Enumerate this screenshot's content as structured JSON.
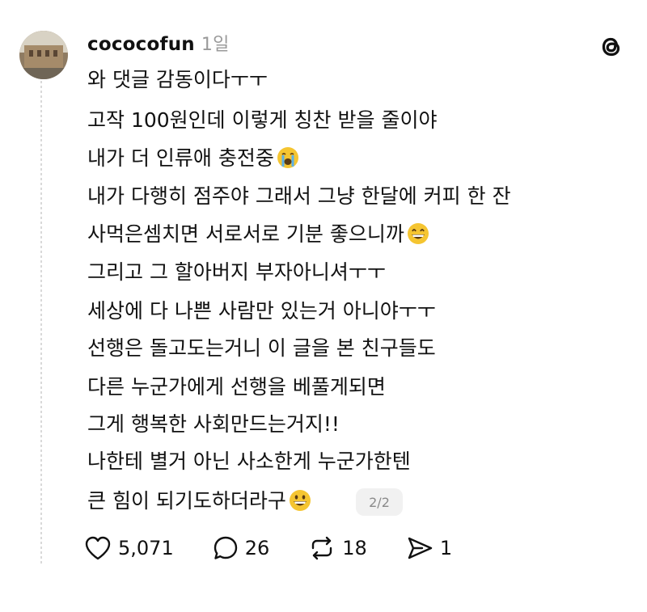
{
  "post": {
    "username": "cococofun",
    "timestamp": "1일",
    "lines": [
      {
        "text": "와 댓글 감동이다ㅜㅜ",
        "emoji": null
      },
      {
        "text": "고작 100원인데 이렇게 칭찬 받을 줄이야",
        "emoji": null
      },
      {
        "text": "내가 더 인류애 충전중",
        "emoji": "crying-face-icon"
      },
      {
        "text": "내가 다행히 점주야 그래서 그냥 한달에 커피 한 잔",
        "emoji": null
      },
      {
        "text": "사먹은셈치면 서로서로 기분 좋으니까",
        "emoji": "grinning-face-icon"
      },
      {
        "text": "그리고 그 할아버지 부자아니셔ㅜㅜ",
        "emoji": null
      },
      {
        "text": "세상에 다 나쁜 사람만 있는거 아니야ㅜㅜ",
        "emoji": null
      },
      {
        "text": "선행은 돌고도는거니 이 글을 본 친구들도",
        "emoji": null
      },
      {
        "text": "다른 누군가에게 선행을 베풀게되면",
        "emoji": null
      },
      {
        "text": "그게 행복한 사회만드는거지!!",
        "emoji": null
      },
      {
        "text": "나한테 별거 아닌 사소한게 누군가한텐",
        "emoji": null
      },
      {
        "text": "큰 힘이 되기도하더라구",
        "emoji": "smiling-face-icon"
      }
    ],
    "page_indicator": "2/2"
  },
  "actions": {
    "likes": "5,071",
    "replies": "26",
    "reposts": "18",
    "shares": "1"
  },
  "icons": [
    "threads-logo-icon",
    "heart-icon",
    "reply-icon",
    "repost-icon",
    "share-icon"
  ],
  "colors": {
    "text": "#111111",
    "muted": "#9a9a9a",
    "emoji_face": "#f5c531",
    "tear": "#5bb0e8"
  }
}
